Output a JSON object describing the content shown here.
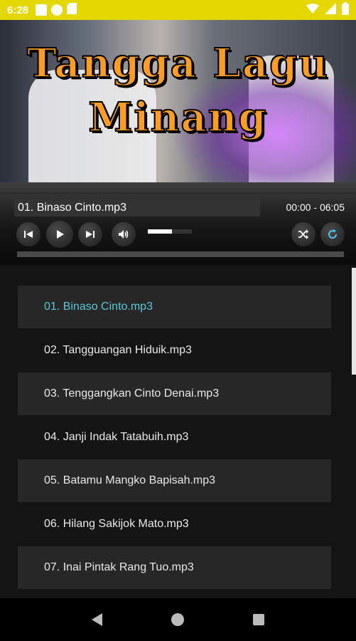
{
  "status": {
    "time": "6:28",
    "bar_color": "#e4d800",
    "icons_left": [
      "app-icon",
      "app-icon",
      "sd-card-icon"
    ],
    "icons_right": [
      "wifi-icon",
      "signal-icon",
      "battery-icon"
    ]
  },
  "banner": {
    "title_line1": "Tangga Lagu",
    "title_line2": "Minang",
    "title_color": "#ff9d1f"
  },
  "player": {
    "current_track": "01. Binaso Cinto.mp3",
    "time": "00:00 - 06:05",
    "volume_level": 0.55,
    "progress": 0,
    "controls": [
      "previous-icon",
      "play-icon",
      "next-icon",
      "volume-icon",
      "shuffle-icon",
      "repeat-icon"
    ],
    "repeat_color": "#4fc3e8"
  },
  "playlist": {
    "active_color": "#5ac8d8",
    "active_index": 0,
    "items": [
      "01. Binaso Cinto.mp3",
      "02. Tangguangan Hiduik.mp3",
      "03. Tenggangkan Cinto Denai.mp3",
      "04. Janji Indak Tatabuih.mp3",
      "05. Batamu Mangko Bapisah.mp3",
      "06. Hilang Sakijok Mato.mp3",
      "07. Inai Pintak Rang Tuo.mp3"
    ]
  },
  "nav": [
    "back-icon",
    "home-icon",
    "recents-icon"
  ]
}
